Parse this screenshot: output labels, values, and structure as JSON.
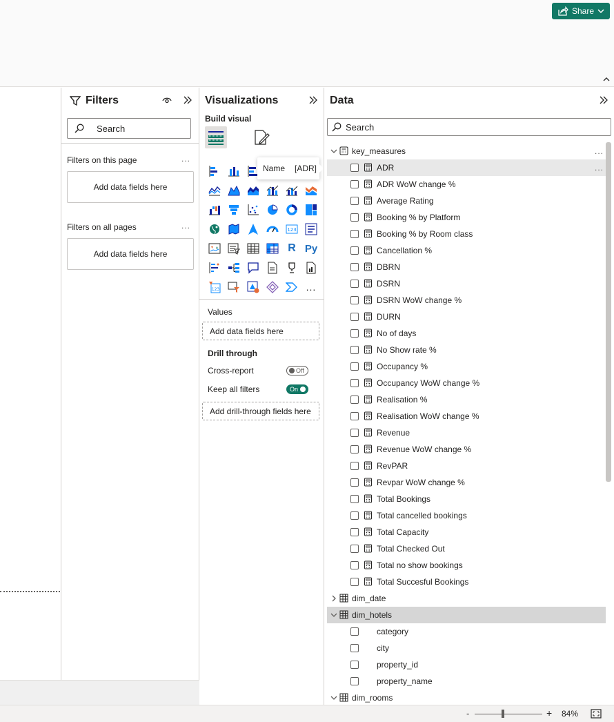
{
  "header": {
    "share_label": "Share"
  },
  "filters": {
    "title": "Filters",
    "search_placeholder": "Search",
    "on_this_page_label": "Filters on this page",
    "on_this_page_drop": "Add data fields here",
    "on_all_pages_label": "Filters on all pages",
    "on_all_pages_drop": "Add data fields here",
    "more": "..."
  },
  "visualizations": {
    "title": "Visualizations",
    "build_visual_label": "Build visual",
    "values_label": "Values",
    "values_drop": "Add data fields here",
    "drill_through_label": "Drill through",
    "cross_report_label": "Cross-report",
    "cross_report_state": "Off",
    "keep_filters_label": "Keep all filters",
    "keep_filters_state": "On",
    "drill_drop": "Add drill-through fields here",
    "r_label": "R",
    "py_label": "Py",
    "more": "..."
  },
  "tooltip": {
    "key": "Name",
    "value": "[ADR]"
  },
  "data_pane": {
    "title": "Data",
    "search_placeholder": "Search",
    "more": "...",
    "tables": [
      {
        "name": "key_measures",
        "expanded": true,
        "fields": [
          "ADR",
          "ADR WoW change %",
          "Average Rating",
          "Booking % by Platform",
          "Booking % by Room class",
          "Cancellation %",
          "DBRN",
          "DSRN",
          "DSRN WoW change %",
          "DURN",
          "No of days",
          "No Show rate %",
          "Occupancy %",
          "Occupancy WoW change %",
          "Realisation %",
          "Realisation WoW change %",
          "Revenue",
          "Revenue WoW change %",
          "RevPAR",
          "Revpar WoW change %",
          "Total Bookings",
          "Total cancelled bookings",
          "Total Capacity",
          "Total Checked Out",
          "Total no show bookings",
          "Total Succesful Bookings"
        ]
      },
      {
        "name": "dim_date",
        "expanded": false,
        "fields": []
      },
      {
        "name": "dim_hotels",
        "expanded": true,
        "fields": [
          "category",
          "city",
          "property_id",
          "property_name"
        ]
      },
      {
        "name": "dim_rooms",
        "expanded": true,
        "fields": []
      }
    ]
  },
  "status_bar": {
    "zoom_minus": "-",
    "zoom_plus": "+",
    "zoom_percent": "84%",
    "zoom_level": 0.42
  },
  "colors": {
    "accent": "#117865",
    "visual_blue": "#118dff",
    "visual_navy": "#12239e",
    "visual_orange": "#e66c37"
  }
}
